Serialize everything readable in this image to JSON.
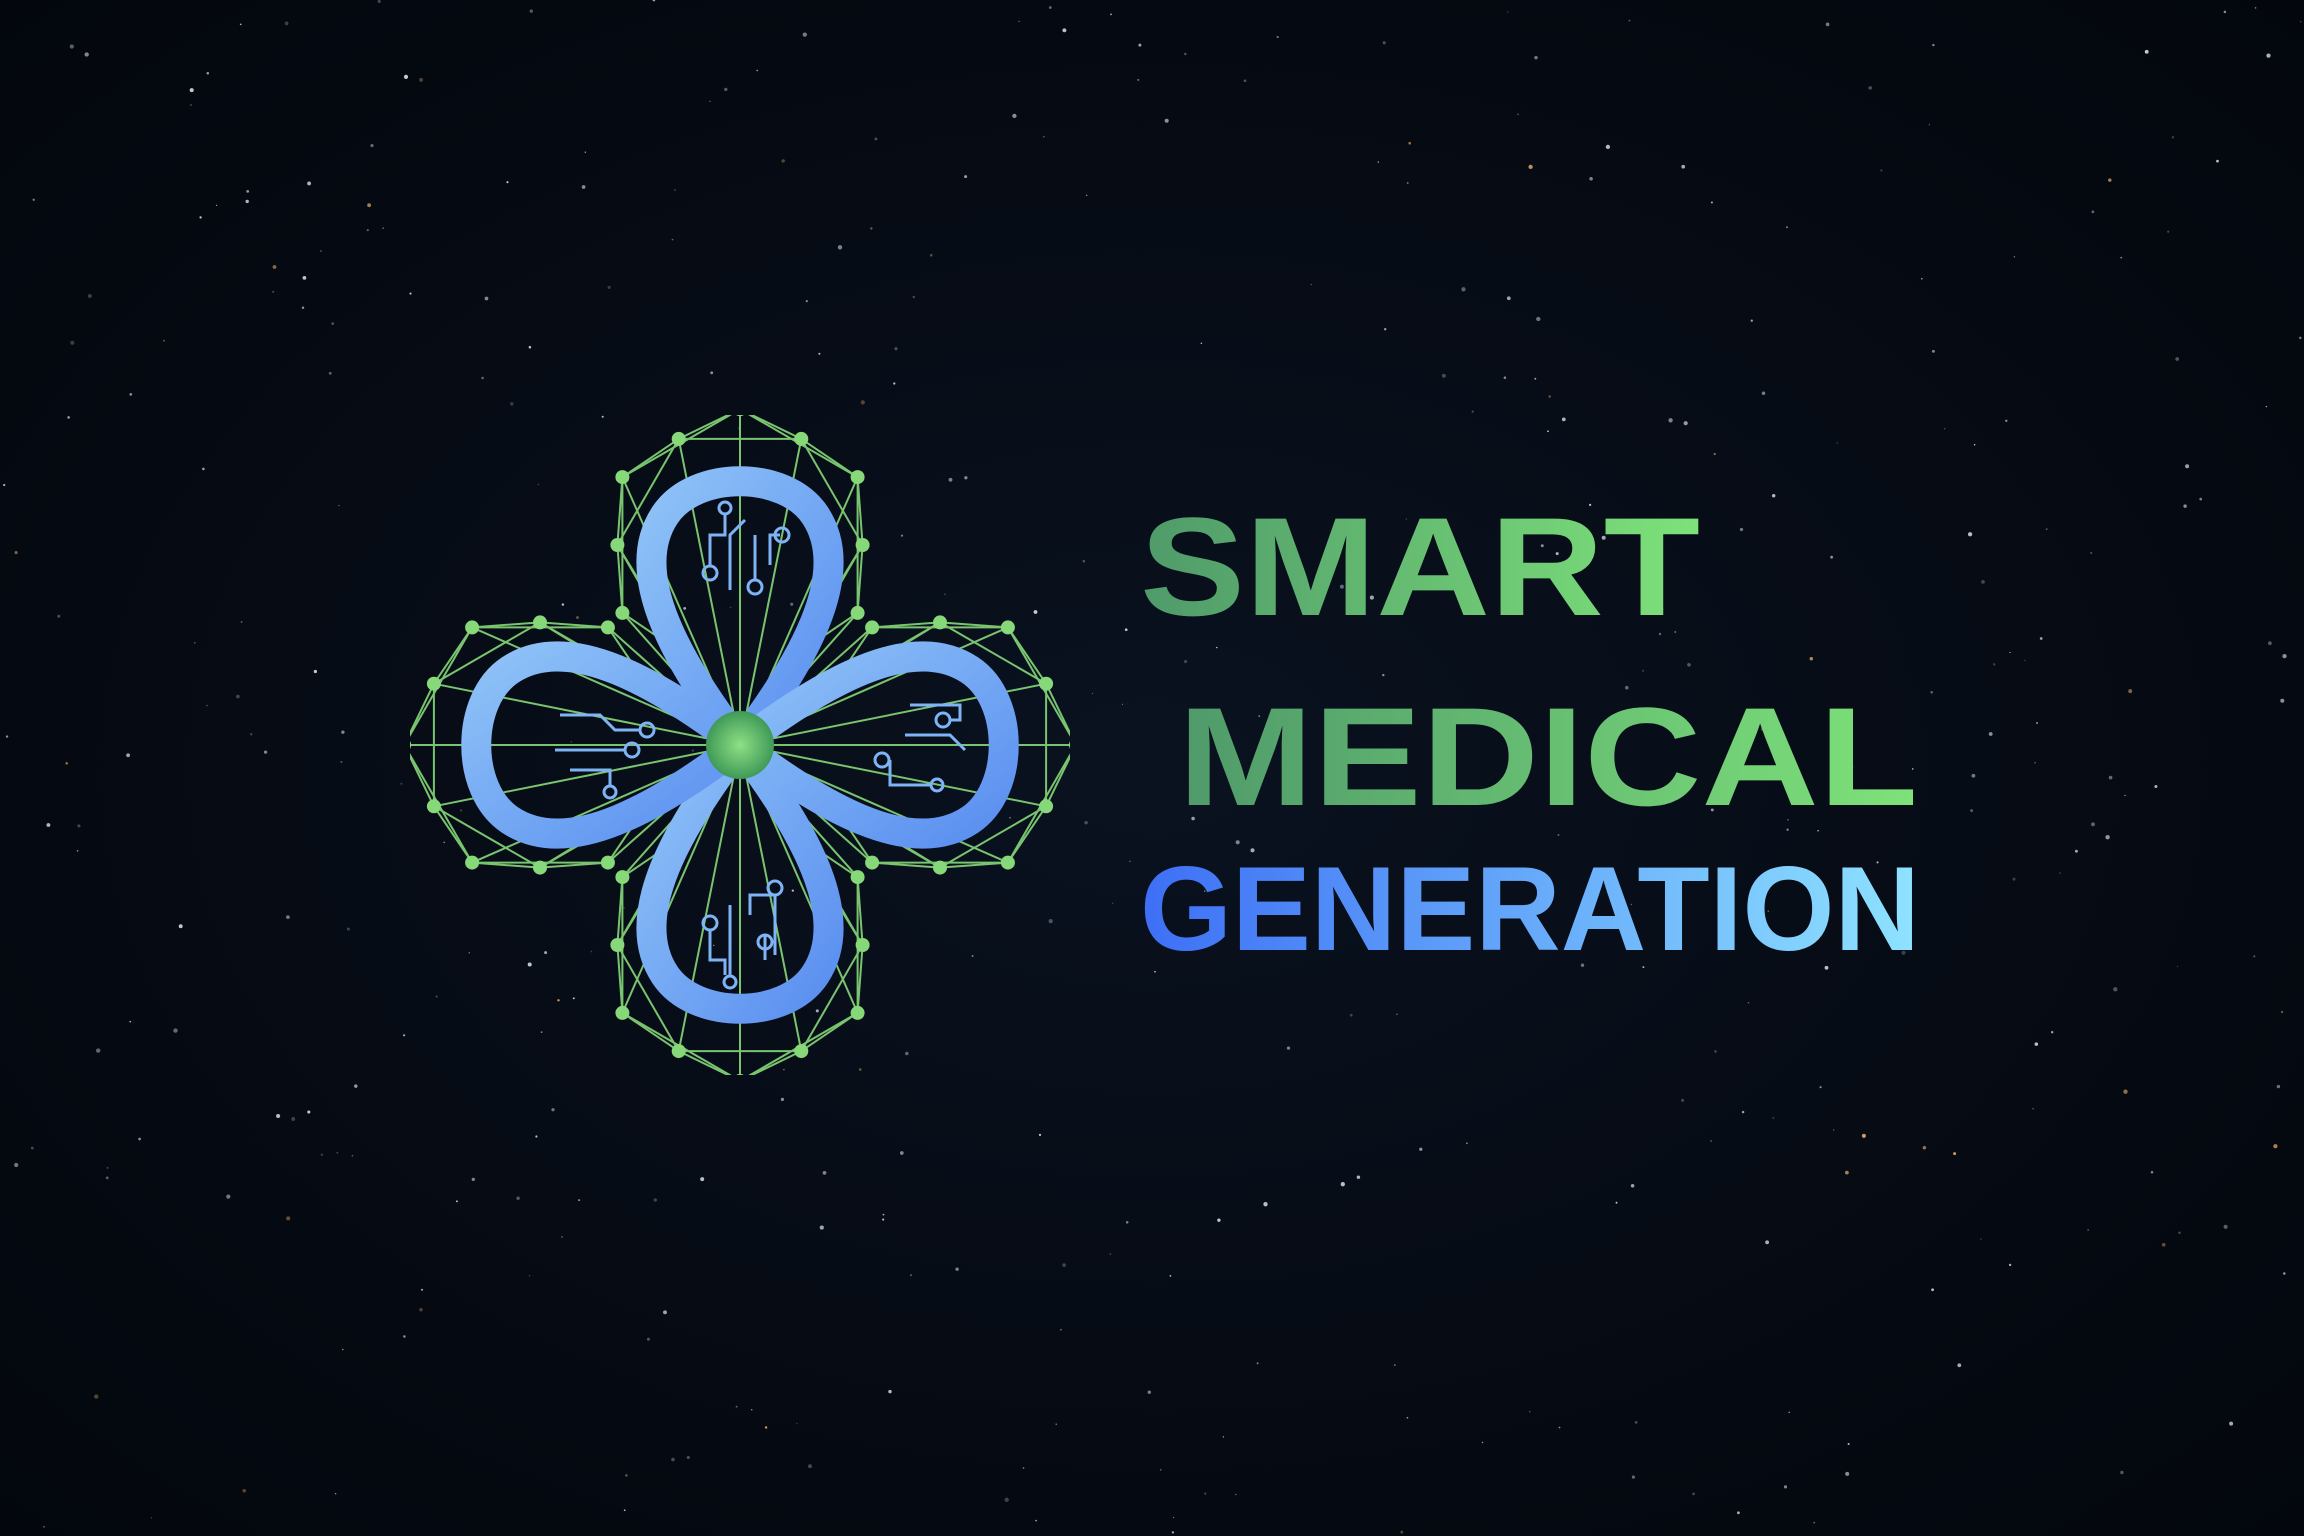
{
  "logo": {
    "icon": "medical-cross-circuit-icon",
    "line1": "SMART",
    "line2": "MEDICAL",
    "line3": "GENERATION"
  },
  "colors": {
    "background": "#050a12",
    "green_dark": "#4f9a6a",
    "green_light": "#7ee27a",
    "blue_dark": "#3d6ff5",
    "blue_light": "#8fe3ff",
    "petal": "#6fa7f2",
    "network": "#86d879"
  }
}
